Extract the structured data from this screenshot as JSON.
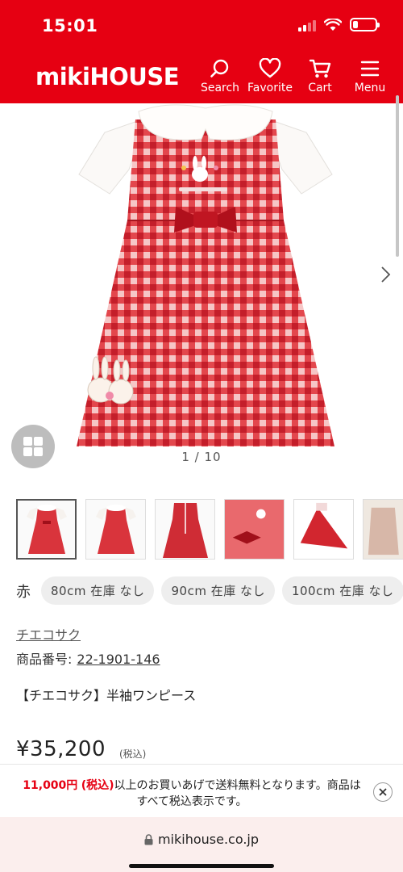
{
  "status_bar": {
    "time": "15:01"
  },
  "header": {
    "logo": "mikiHOUSE",
    "nav": [
      {
        "label": "Search",
        "icon": "search-icon"
      },
      {
        "label": "Favorite",
        "icon": "heart-icon"
      },
      {
        "label": "Cart",
        "icon": "cart-icon"
      },
      {
        "label": "Menu",
        "icon": "hamburger-icon"
      }
    ],
    "brand_color": "#e60012"
  },
  "gallery": {
    "counter": "1 / 10",
    "image_desc": "red gingham short-sleeve dress with white collar and bunny embroidery"
  },
  "product": {
    "color": "赤",
    "sizes": [
      {
        "label": "80cm 在庫 なし"
      },
      {
        "label": "90cm 在庫 なし"
      },
      {
        "label": "100cm 在庫 なし"
      }
    ],
    "brand_link": "チエコサク",
    "sku_label": "商品番号:",
    "sku": "22-1901-146",
    "name": "【チエコサク】半袖ワンピース",
    "price": "¥35,200",
    "tax_note": "(税込)"
  },
  "banner": {
    "amount": "11,000円",
    "tax": "(税込)",
    "text": "以上のお買いあげで送料無料となります。商品はすべて税込表示です。"
  },
  "browser": {
    "url": "mikihouse.co.jp"
  }
}
